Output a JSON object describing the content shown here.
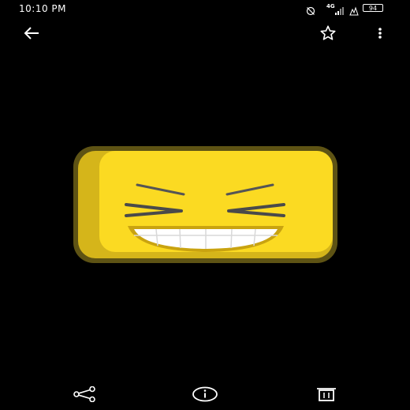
{
  "status_bar": {
    "time": "10:10 PM",
    "network": "4G",
    "battery": "94",
    "icons": [
      "do-not-disturb-icon",
      "signal-icon",
      "alert-icon",
      "battery-icon"
    ]
  },
  "toolbar": {
    "icons": [
      "back-arrow-icon",
      "star-outline-icon",
      "more-vert-icon"
    ]
  },
  "image": {
    "subject": "laughing-squinting-emoji",
    "colors": {
      "face": "#FBDA22",
      "shade": "#D5B51A",
      "outline": "#5E5314",
      "eyes": "#4A4A4A",
      "mouth": "#C9A310"
    }
  },
  "bottom_bar": {
    "icons": [
      "share-icon",
      "info-icon",
      "delete-icon"
    ]
  }
}
